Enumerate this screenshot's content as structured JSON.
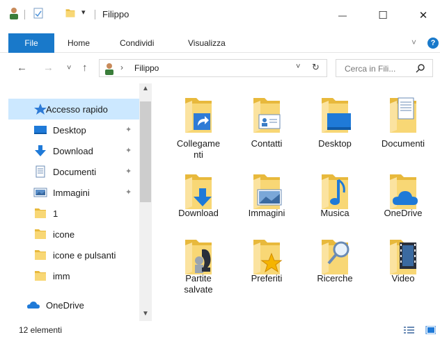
{
  "window": {
    "title": "Filippo",
    "minimize": "—",
    "maximize": "☐",
    "close": "✕"
  },
  "ribbon": {
    "tabs": [
      "File",
      "Home",
      "Condividi",
      "Visualizza"
    ],
    "expand": "˅",
    "help": "?"
  },
  "address": {
    "back": "←",
    "forward": "→",
    "recent": "˅",
    "up": "↑",
    "separator": "›",
    "path": "Filippo",
    "dropdown": "˅",
    "refresh": "↻"
  },
  "search": {
    "placeholder": "Cerca in Fili..."
  },
  "nav": {
    "items": [
      {
        "label": "Accesso rapido",
        "icon": "star-icon",
        "pinned": false
      },
      {
        "label": "Desktop",
        "icon": "desktop-icon",
        "pinned": true
      },
      {
        "label": "Download",
        "icon": "download-icon",
        "pinned": true
      },
      {
        "label": "Documenti",
        "icon": "document-icon",
        "pinned": true
      },
      {
        "label": "Immagini",
        "icon": "pictures-icon",
        "pinned": true
      },
      {
        "label": "1",
        "icon": "folder-icon",
        "pinned": false
      },
      {
        "label": "icone",
        "icon": "folder-icon",
        "pinned": false
      },
      {
        "label": "icone e pulsanti",
        "icon": "folder-icon",
        "pinned": false
      },
      {
        "label": "imm",
        "icon": "folder-icon",
        "pinned": false
      },
      {
        "label": "OneDrive",
        "icon": "onedrive-icon",
        "pinned": false
      }
    ],
    "pin_glyph": "📌"
  },
  "files": [
    {
      "line1": "Collegame",
      "line2": "nti",
      "icon": "links-folder-icon"
    },
    {
      "line1": "Contatti",
      "line2": "",
      "icon": "contacts-folder-icon"
    },
    {
      "line1": "Desktop",
      "line2": "",
      "icon": "desktop-folder-icon"
    },
    {
      "line1": "Documenti",
      "line2": "",
      "icon": "documents-folder-icon"
    },
    {
      "line1": "Download",
      "line2": "",
      "icon": "downloads-folder-icon"
    },
    {
      "line1": "Immagini",
      "line2": "",
      "icon": "pictures-folder-icon"
    },
    {
      "line1": "Musica",
      "line2": "",
      "icon": "music-folder-icon"
    },
    {
      "line1": "OneDrive",
      "line2": "",
      "icon": "onedrive-folder-icon"
    },
    {
      "line1": "Partite",
      "line2": "salvate",
      "icon": "saved-games-folder-icon"
    },
    {
      "line1": "Preferiti",
      "line2": "",
      "icon": "favorites-folder-icon"
    },
    {
      "line1": "Ricerche",
      "line2": "",
      "icon": "searches-folder-icon"
    },
    {
      "line1": "Video",
      "line2": "",
      "icon": "videos-folder-icon"
    }
  ],
  "status": {
    "count": "12 elementi"
  },
  "colors": {
    "accent": "#1979ca",
    "folder": "#f8d775",
    "folder_dark": "#e8b93c",
    "selection": "#cce8ff"
  }
}
